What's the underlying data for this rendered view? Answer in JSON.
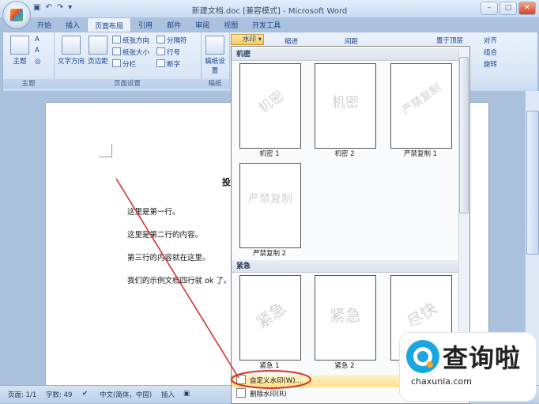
{
  "window": {
    "title": "新建文档.doc [兼容模式] - Microsoft Word",
    "qat_undo": "↶",
    "qat_redo": "↷",
    "qat_save": "▣",
    "qat_more": "▾",
    "minimize": "–",
    "maximize": "□",
    "close": "✕"
  },
  "tabs": [
    "开始",
    "插入",
    "页面布局",
    "引用",
    "邮件",
    "审阅",
    "视图",
    "开发工具"
  ],
  "active_tab": "页面布局",
  "ribbon": {
    "themes_group": {
      "label": "主题",
      "theme_btn": "主题",
      "colors": "A",
      "fonts": "A",
      "effects": "◎"
    },
    "page_setup_group": {
      "label": "页面设置",
      "text_direction": "文字方向",
      "margins": "页边距",
      "orientation": "纸张方向",
      "size": "纸张大小",
      "columns": "分栏",
      "breaks": "分隔符",
      "line_numbers": "行号",
      "hyphenation": "断字"
    },
    "draft_group": {
      "label": "稿纸",
      "draft_btn": "稿纸设置"
    },
    "page_bg": {
      "watermark_btn": "水印",
      "indent": "缩进",
      "spacing": "间距"
    },
    "arrange": {
      "bring_front": "置于顶层",
      "align": "对齐",
      "combine": "组合",
      "rotate": "旋转"
    }
  },
  "document": {
    "title_partial": "投",
    "lines": [
      "这里是第一行。",
      "这里是第二行的内容。",
      "第三行的内容就在这里。",
      "我们的示例文档四行就 ok 了。"
    ]
  },
  "watermark_panel": {
    "section1": "机密",
    "section2": "紧急",
    "thumbs_confidential": [
      {
        "text": "机密",
        "caption": "机密 1"
      },
      {
        "text": "机密",
        "caption": "机密 2"
      },
      {
        "text": "严禁复制",
        "caption": "严禁复制 1"
      },
      {
        "text": "严禁复制",
        "caption": "严禁复制 2"
      }
    ],
    "thumbs_urgent": [
      {
        "text": "紧急",
        "caption": "紧急 1"
      },
      {
        "text": "紧急",
        "caption": "紧急 2"
      },
      {
        "text": "尽快",
        "caption": ""
      }
    ],
    "custom_watermark": "自定义水印(W)...",
    "remove_watermark": "删除水印(R)"
  },
  "statusbar": {
    "page": "页面: 1/1",
    "words": "字数: 49",
    "language": "中文(简体，中国)",
    "insert_mode": "插入"
  },
  "brand": {
    "name": "查询啦",
    "url": "chaxunla.com"
  },
  "colors": {
    "annotation": "#d8332b",
    "brand_blue": "#1aa6e0",
    "brand_orange": "#f6a623"
  }
}
